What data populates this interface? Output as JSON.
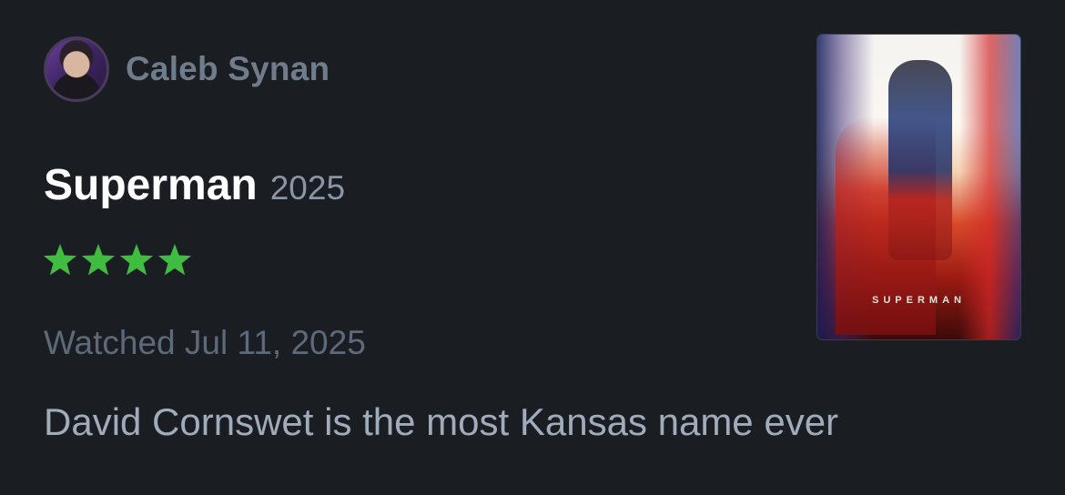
{
  "review": {
    "author": {
      "name": "Caleb Synan",
      "avatar_icon": "user-avatar"
    },
    "film": {
      "title": "Superman",
      "year": "2025",
      "poster_title": "SUPERMAN"
    },
    "rating": {
      "stars": 4,
      "max_stars": 5,
      "star_color": "#40bc40",
      "star_icon": "star-icon"
    },
    "watched": "Watched Jul 11, 2025",
    "text": "David Cornswet is the most Kansas name ever"
  },
  "colors": {
    "background": "#1a1d21",
    "title": "#ffffff",
    "author": "#6f7c8c",
    "muted": "#5d6a79",
    "body": "#a0acbb",
    "accent_green": "#40bc40"
  }
}
